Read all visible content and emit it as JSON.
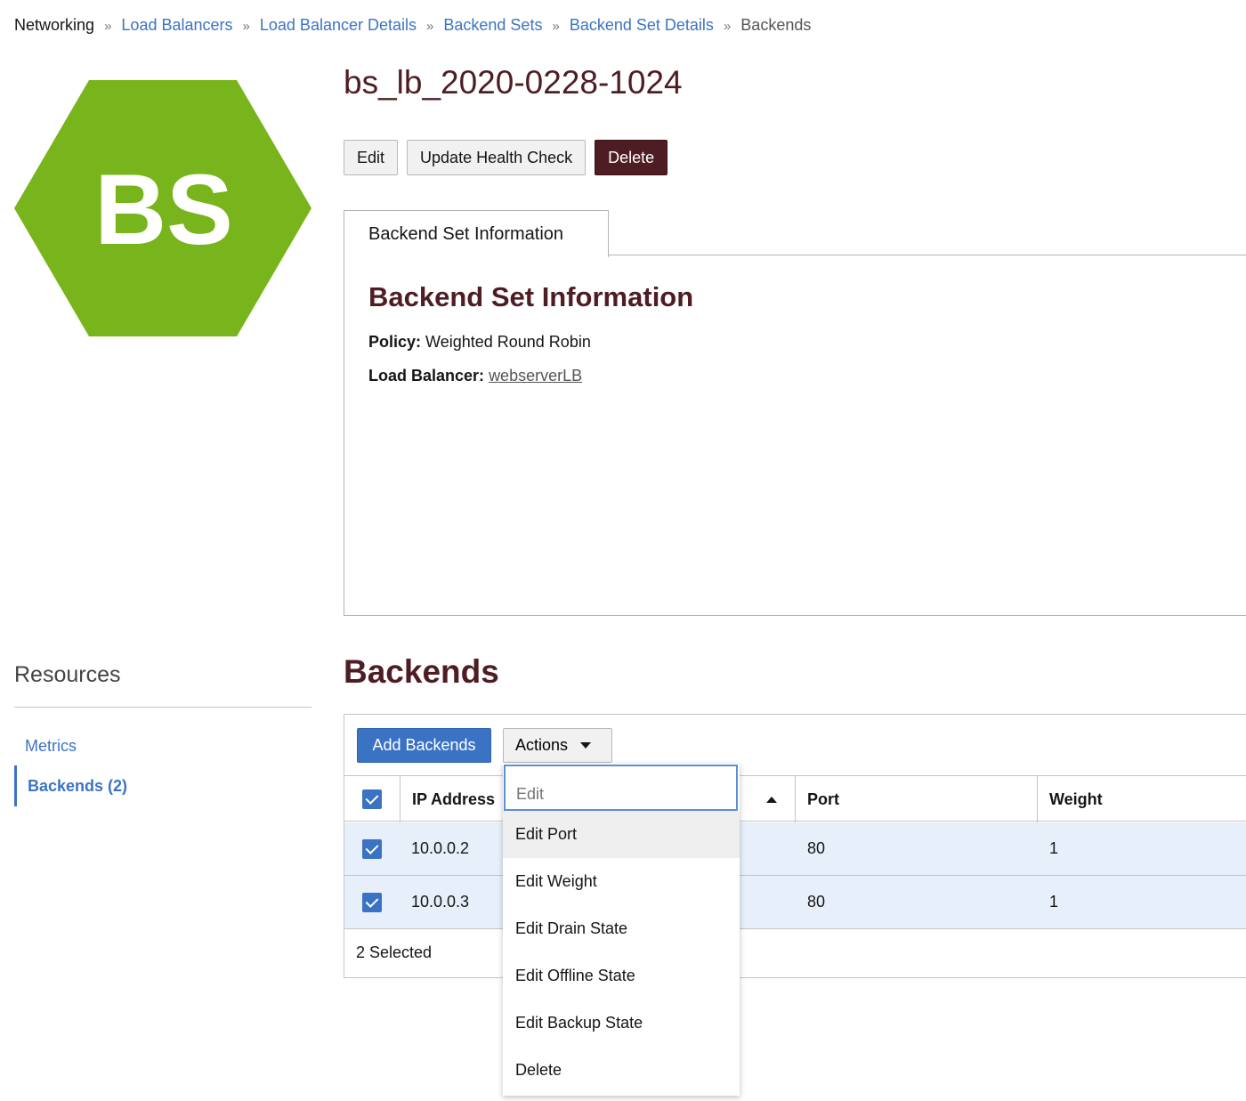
{
  "breadcrumb": {
    "root": "Networking",
    "items": [
      "Load Balancers",
      "Load Balancer Details",
      "Backend Sets",
      "Backend Set Details"
    ],
    "current": "Backends",
    "separator": "»"
  },
  "resource_icon": {
    "text": "BS",
    "color": "#78b41b"
  },
  "page": {
    "title": "bs_lb_2020-0228-1024",
    "buttons": {
      "edit": "Edit",
      "update_health_check": "Update Health Check",
      "delete": "Delete"
    }
  },
  "info": {
    "tab_label": "Backend Set Information",
    "heading": "Backend Set Information",
    "policy_label": "Policy:",
    "policy_value": "Weighted Round Robin",
    "lb_label": "Load Balancer:",
    "lb_value": "webserverLB"
  },
  "resources": {
    "title": "Resources",
    "items": [
      {
        "label": "Metrics",
        "active": false
      },
      {
        "label": "Backends (2)",
        "active": true
      }
    ]
  },
  "backends": {
    "title": "Backends",
    "add_button": "Add Backends",
    "actions_button": "Actions",
    "columns": [
      "IP Address",
      "Port",
      "Weight"
    ],
    "rows": [
      {
        "ip": "10.0.0.2",
        "port": "80",
        "weight": "1",
        "checked": true
      },
      {
        "ip": "10.0.0.3",
        "port": "80",
        "weight": "1",
        "checked": true
      }
    ],
    "selected_text": "2 Selected"
  },
  "actions_menu": {
    "search_placeholder": "Edit",
    "items": [
      "Edit Port",
      "Edit Weight",
      "Edit Drain State",
      "Edit Offline State",
      "Edit Backup State",
      "Delete"
    ]
  },
  "colors": {
    "accent": "#3b73c4",
    "brand_dark": "#4e1d23",
    "hex_green": "#78b41b",
    "row_selected": "#e7f0fa"
  }
}
